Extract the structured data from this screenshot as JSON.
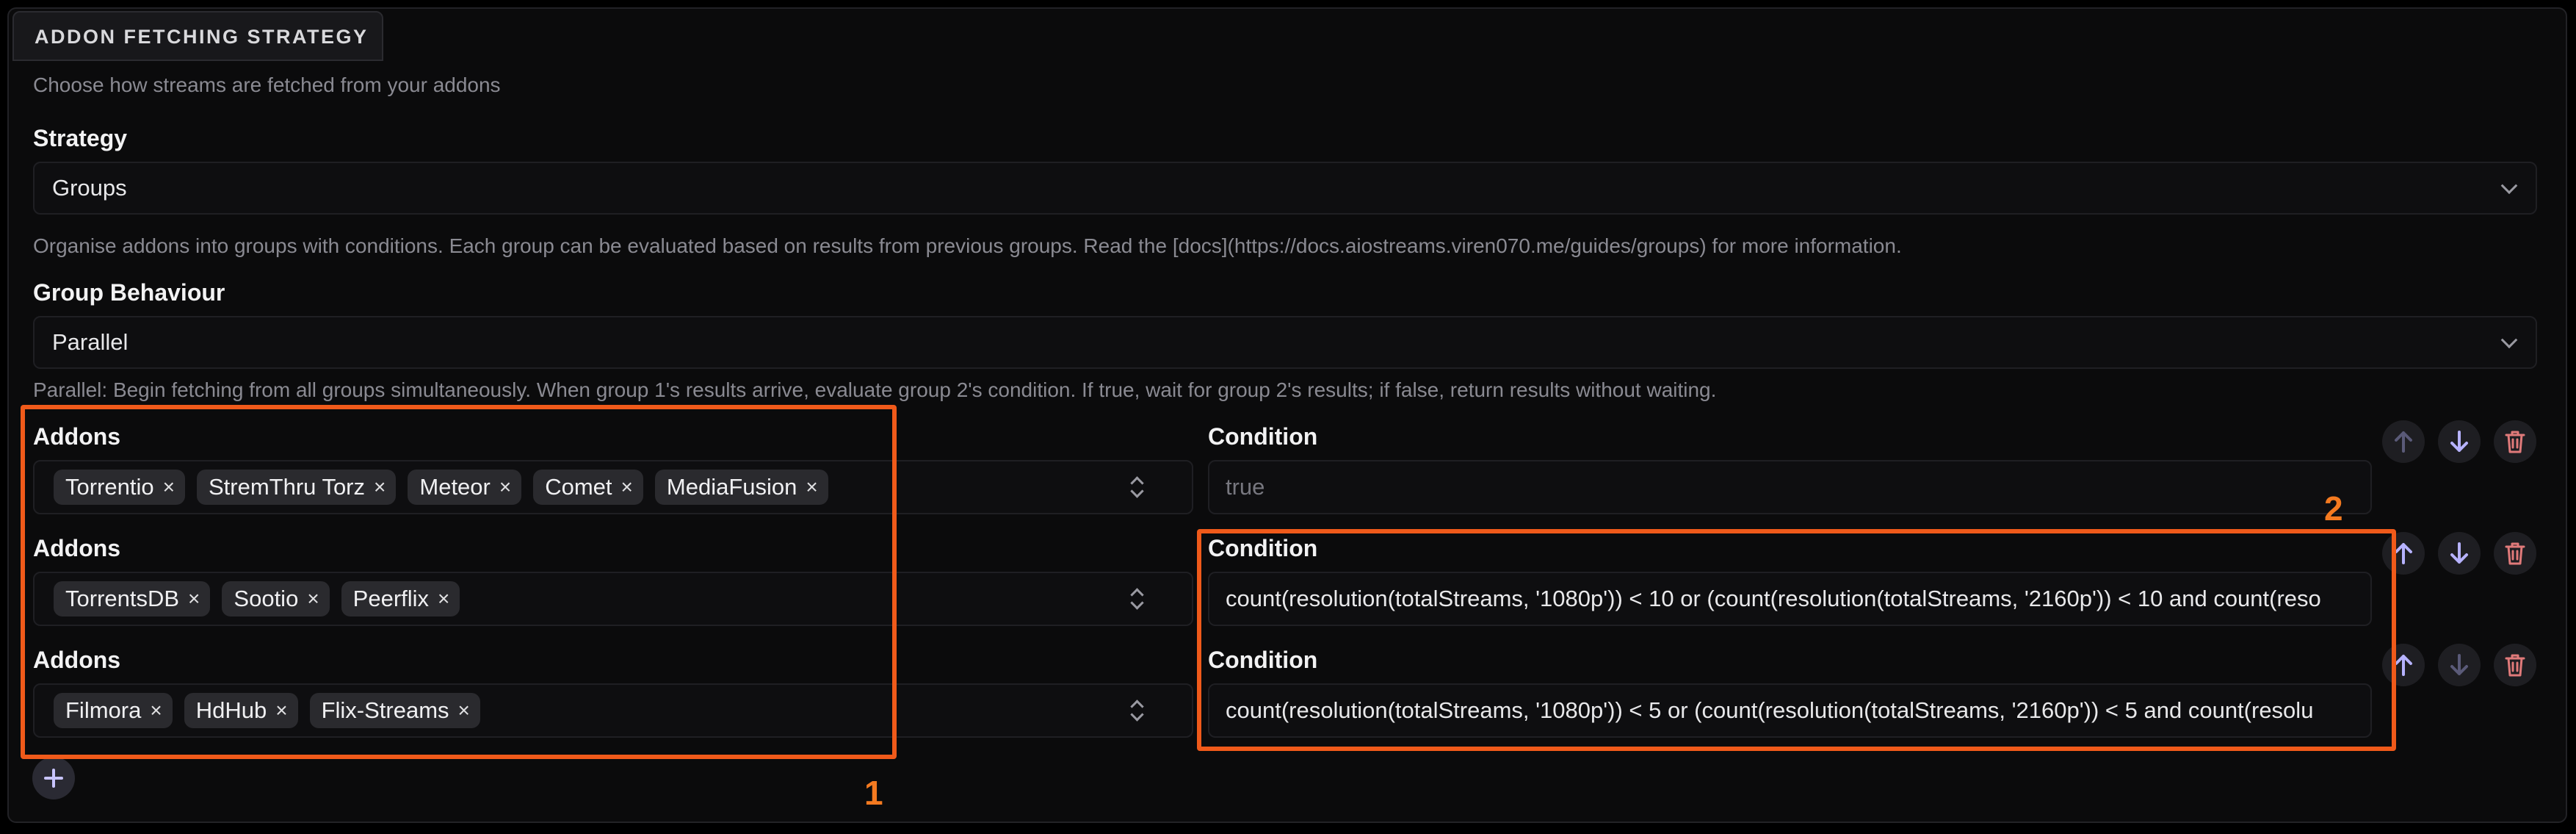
{
  "section": {
    "title": "ADDON FETCHING STRATEGY",
    "description": "Choose how streams are fetched from your addons"
  },
  "strategy": {
    "label": "Strategy",
    "value": "Groups",
    "help": "Organise addons into groups with conditions. Each group can be evaluated based on results from previous groups. Read the [docs](https://docs.aiostreams.viren070.me/guides/groups) for more information."
  },
  "group_behaviour": {
    "label": "Group Behaviour",
    "value": "Parallel",
    "help": "Parallel: Begin fetching from all groups simultaneously. When group 1's results arrive, evaluate group 2's condition. If true, wait for group 2's results; if false, return results without waiting."
  },
  "groups": [
    {
      "addons_label": "Addons",
      "addons": [
        "Torrentio",
        "StremThru Torz",
        "Meteor",
        "Comet",
        "MediaFusion"
      ],
      "condition_label": "Condition",
      "condition": "",
      "condition_placeholder": "true"
    },
    {
      "addons_label": "Addons",
      "addons": [
        "TorrentsDB",
        "Sootio",
        "Peerflix"
      ],
      "condition_label": "Condition",
      "condition": "count(resolution(totalStreams, '1080p')) < 10 or (count(resolution(totalStreams, '2160p')) < 10 and count(reso",
      "condition_placeholder": ""
    },
    {
      "addons_label": "Addons",
      "addons": [
        "Filmora",
        "HdHub",
        "Flix-Streams"
      ],
      "condition_label": "Condition",
      "condition": "count(resolution(totalStreams, '1080p')) < 5 or (count(resolution(totalStreams, '2160p')) < 5 and count(resolu",
      "condition_placeholder": ""
    }
  ],
  "annotations": {
    "box1_label": "1",
    "box2_label": "2",
    "color": "#f05a1a"
  },
  "icons": {
    "remove": "×",
    "move_up": "arrow-up-icon",
    "move_down": "arrow-down-icon",
    "delete": "trash-icon",
    "add": "plus-icon"
  },
  "colors": {
    "background": "#000000",
    "panel": "#0b0b0c",
    "chip": "#2a2a2e",
    "arrow_active": "#b6b2ff",
    "arrow_disabled": "#5a5a78",
    "trash": "#e07a7a"
  }
}
